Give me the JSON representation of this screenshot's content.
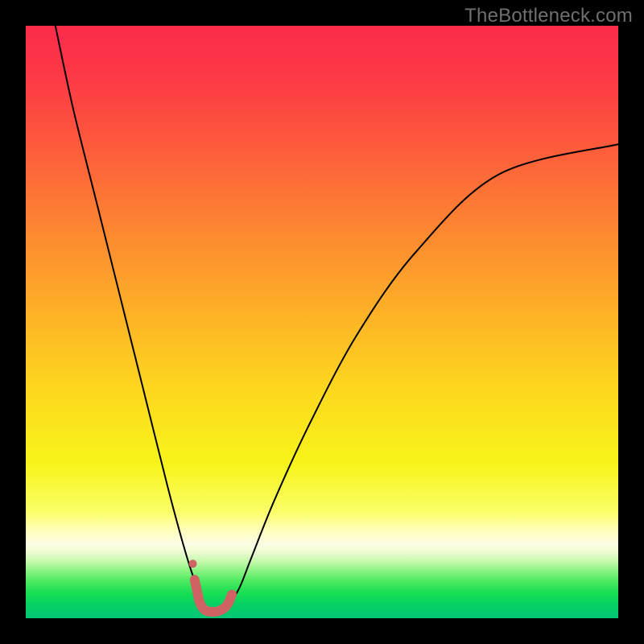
{
  "watermark": "TheBottleneck.com",
  "chart_data": {
    "type": "line",
    "title": "",
    "xlabel": "",
    "ylabel": "",
    "xlim": [
      0,
      100
    ],
    "ylim": [
      0,
      100
    ],
    "grid": false,
    "legend": false,
    "series": [
      {
        "name": "bottleneck-curve",
        "x": [
          5,
          8,
          12,
          16,
          20,
          24,
          27,
          29,
          30.5,
          31.5,
          32.5,
          34,
          36,
          38,
          42,
          48,
          56,
          66,
          80,
          100
        ],
        "y": [
          100,
          86,
          70,
          54,
          38,
          22,
          11,
          5,
          2,
          1.2,
          1.2,
          2,
          5,
          10,
          20,
          33,
          48,
          62,
          75,
          80
        ],
        "color": "#000000",
        "width": 2
      },
      {
        "name": "valley-trace",
        "x": [
          28.5,
          29,
          29.2,
          29.4,
          29.6,
          30,
          30.6,
          31.2,
          32,
          32.8,
          33.6,
          34.2,
          34.8
        ],
        "y": [
          6.5,
          4.2,
          3.2,
          2.6,
          2.2,
          1.6,
          1.2,
          1.1,
          1.1,
          1.3,
          1.8,
          2.6,
          4.0
        ],
        "color": "#cf6363",
        "width": 12
      },
      {
        "name": "valley-marker",
        "type": "scatter",
        "x": [
          28.2
        ],
        "y": [
          9.2
        ],
        "color": "#cf6363",
        "size": 10
      }
    ],
    "gradient_stops": [
      {
        "offset": 0.0,
        "color": "#fc2b4a"
      },
      {
        "offset": 0.09,
        "color": "#fd3a45"
      },
      {
        "offset": 0.2,
        "color": "#fd5a3c"
      },
      {
        "offset": 0.33,
        "color": "#fd8232"
      },
      {
        "offset": 0.48,
        "color": "#fdb027"
      },
      {
        "offset": 0.62,
        "color": "#fdd91e"
      },
      {
        "offset": 0.74,
        "color": "#f7f41a"
      },
      {
        "offset": 0.82,
        "color": "#fbfe68"
      },
      {
        "offset": 0.855,
        "color": "#ffffc2"
      },
      {
        "offset": 0.874,
        "color": "#fefce4"
      },
      {
        "offset": 0.89,
        "color": "#e9fbcf"
      },
      {
        "offset": 0.905,
        "color": "#c1f9aa"
      },
      {
        "offset": 0.92,
        "color": "#8af482"
      },
      {
        "offset": 0.938,
        "color": "#4aea5f"
      },
      {
        "offset": 0.958,
        "color": "#16de54"
      },
      {
        "offset": 0.978,
        "color": "#05d063"
      },
      {
        "offset": 1.0,
        "color": "#05c678"
      }
    ]
  }
}
